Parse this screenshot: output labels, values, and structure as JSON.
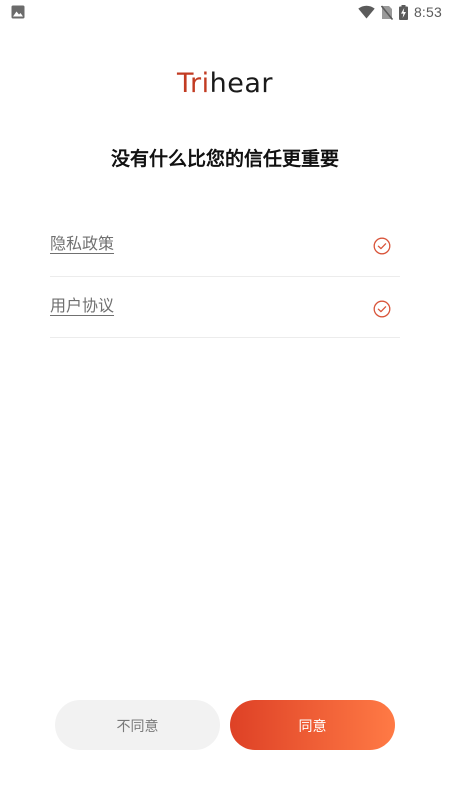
{
  "status_bar": {
    "time": "8:53",
    "left_icon": "image-icon",
    "icons": [
      "wifi-icon",
      "no-sim-icon",
      "battery-charging-icon"
    ]
  },
  "logo": {
    "part_a": "Tri",
    "part_b": "hear",
    "colors": {
      "part_a": "#c23b22",
      "part_b": "#1a1a1a"
    }
  },
  "headline": "没有什么比您的信任更重要",
  "agreements": [
    {
      "label": "隐私政策",
      "checked": true,
      "icon": "check-circle-icon"
    },
    {
      "label": "用户协议",
      "checked": true,
      "icon": "check-circle-icon"
    }
  ],
  "buttons": {
    "disagree_label": "不同意",
    "agree_label": "同意"
  },
  "colors": {
    "accent_start": "#de4126",
    "accent_end": "#ff7a45",
    "check": "#d9553b",
    "disagree_bg": "#f2f2f2"
  }
}
